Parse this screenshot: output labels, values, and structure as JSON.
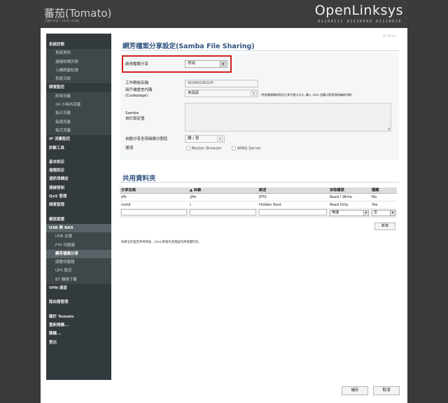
{
  "header": {
    "title": "蕃茄(Tomato)",
    "subtitle": "正體中文版 1.28 by shibby",
    "brand": "OpenLinksys",
    "brand_bits": "01100111 01110000 01110010"
  },
  "version": "RT-N10U",
  "sidebar": {
    "items": [
      {
        "label": "系統狀態",
        "type": "top"
      },
      {
        "label": "系統資訊",
        "type": "sub"
      },
      {
        "label": "連線設備列表",
        "type": "sub"
      },
      {
        "label": "上網調變紀錄",
        "type": "sub"
      },
      {
        "label": "系統日誌",
        "type": "sub"
      },
      {
        "label": "頻寬監控",
        "type": "top"
      },
      {
        "label": "即時流量",
        "type": "sub"
      },
      {
        "label": "24 小時內流量",
        "type": "sub"
      },
      {
        "label": "每日流量",
        "type": "sub"
      },
      {
        "label": "每週流量",
        "type": "sub"
      },
      {
        "label": "每月流量",
        "type": "sub"
      },
      {
        "label": "IP 流量監控",
        "type": "top"
      },
      {
        "label": "診斷工具",
        "type": "top"
      },
      {
        "label": "",
        "type": "gap"
      },
      {
        "label": "基本設定",
        "type": "top"
      },
      {
        "label": "進階設定",
        "type": "top"
      },
      {
        "label": "通訊埠轉送",
        "type": "top"
      },
      {
        "label": "連線管制",
        "type": "top"
      },
      {
        "label": "QoS 管理",
        "type": "top"
      },
      {
        "label": "頻寬管理",
        "type": "top"
      },
      {
        "label": "",
        "type": "gap"
      },
      {
        "label": "網頁認證",
        "type": "top"
      },
      {
        "label": "USB 與 NAS",
        "type": "active-top"
      },
      {
        "label": "USB 支援",
        "type": "sub"
      },
      {
        "label": "FTP 伺服器",
        "type": "sub"
      },
      {
        "label": "網芳檔案分享",
        "type": "active-sub"
      },
      {
        "label": "媒體伺服器",
        "type": "sub"
      },
      {
        "label": "UPS 監控",
        "type": "sub"
      },
      {
        "label": "BT 離線下載",
        "type": "sub"
      },
      {
        "label": "VPN 通道",
        "type": "top"
      },
      {
        "label": "",
        "type": "gap"
      },
      {
        "label": "路由器管理",
        "type": "top"
      },
      {
        "label": "",
        "type": "gap"
      },
      {
        "label": "關於 Tomato",
        "type": "top"
      },
      {
        "label": "重新開機...",
        "type": "top"
      },
      {
        "label": "關機...",
        "type": "top"
      },
      {
        "label": "登出",
        "type": "top"
      }
    ]
  },
  "samba": {
    "title": "網芳檔案分享設定(Samba File Sharing)",
    "enable_label": "啟用檔案分享",
    "enable_value": "停用",
    "workgroup_label": "工作群組名稱",
    "workgroup_value": "WORKGROUP",
    "codepage_label": "用戶端語言代碼",
    "codepage_label2": "(Codepage)",
    "codepage_value": "未指定",
    "codepage_hint": "(找到看網路時程式之命令提示字元, 輸入 chcp 並顯示即是現的編碼代碼)",
    "custom_label": "Samba",
    "custom_label2": "自訂設定值",
    "autoshare_label": "自動分享全部磁碟分割區",
    "autoshare_value": "讀 / 寫",
    "options_label": "選項",
    "master_browser": "Master Browser",
    "wins_server": "WINS Server"
  },
  "shares": {
    "title": "共用資料夾",
    "columns": [
      "分享名稱",
      "▲ 目錄",
      "敘述",
      "存取權限",
      "隱藏"
    ],
    "rows": [
      [
        "jffs",
        "/jffs",
        "JFFS",
        "Read / Write",
        "No"
      ],
      [
        "root$",
        "/",
        "Hidden Root",
        "Read Only",
        "Yes"
      ]
    ],
    "new_access": "唯讀",
    "new_hidden": "否",
    "add_button": "新增",
    "note": "如果沒有指定共用目錄，/mnt 將會作為預設的共用資料夾。"
  },
  "footer": {
    "save": "儲存",
    "cancel": "取消"
  },
  "colors": {
    "sidebar": "#333a3e",
    "title": "#335580",
    "highlight": "#d42020"
  }
}
